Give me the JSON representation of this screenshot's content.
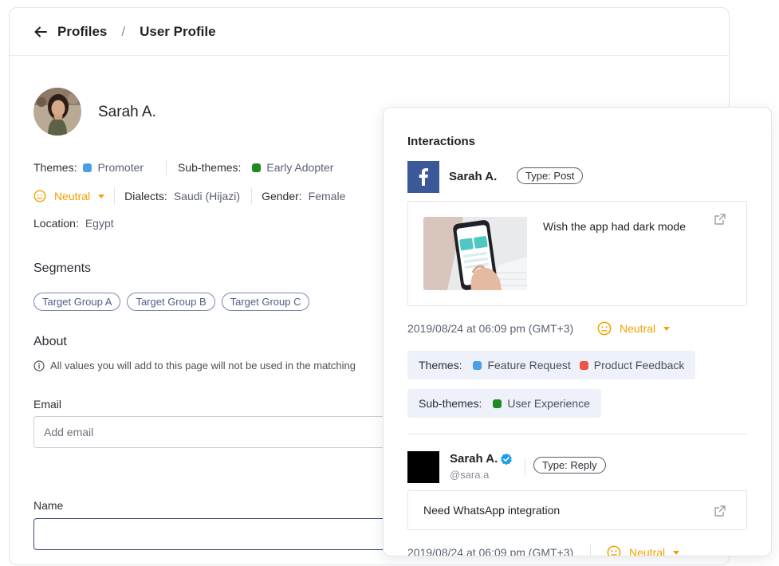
{
  "breadcrumb": {
    "parent": "Profiles",
    "separator": "/",
    "current": "User Profile"
  },
  "profile": {
    "name": "Sarah A.",
    "themes_label": "Themes:",
    "theme": {
      "label": "Promoter",
      "color": "#4a9ee6"
    },
    "subthemes_label": "Sub-themes:",
    "subtheme": {
      "label": "Early Adopter",
      "color": "#1f8a1f"
    },
    "sentiment": "Neutral",
    "dialects_label": "Dialects:",
    "dialect": "Saudi (Hijazi)",
    "gender_label": "Gender:",
    "gender": "Female",
    "location_label": "Location:",
    "location": "Egypt"
  },
  "segments": {
    "title": "Segments",
    "items": [
      "Target Group A",
      "Target Group B",
      "Target Group C"
    ]
  },
  "about": {
    "title": "About",
    "note": "All values you will add to this page will not be used in the matching",
    "email_label": "Email",
    "email_placeholder": "Add email",
    "name_label": "Name"
  },
  "interactions": {
    "title": "Interactions",
    "post1": {
      "author": "Sarah A.",
      "type": "Type: Post",
      "text": "Wish the app had dark mode",
      "timestamp": "2019/08/24 at 06:09 pm (GMT+3)",
      "sentiment": "Neutral",
      "themes_label": "Themes:",
      "themes": [
        {
          "label": "Feature Request",
          "color": "#4a9ee6"
        },
        {
          "label": "Product Feedback",
          "color": "#e8564a"
        }
      ],
      "subthemes_label": "Sub-themes:",
      "subthemes": [
        {
          "label": "User Experience",
          "color": "#1f8a1f"
        }
      ]
    },
    "post2": {
      "author": "Sarah A.",
      "handle": "@sara.a",
      "type": "Type: Reply",
      "text": "Need WhatsApp integration",
      "timestamp": "2019/08/24 at 06:09 pm (GMT+3)",
      "sentiment": "Neutral"
    }
  },
  "colors": {
    "sentiment": "#f2a100",
    "facebook": "#3b5998",
    "verified": "#1d9bf0",
    "chip_bg": "#eef1f9"
  }
}
